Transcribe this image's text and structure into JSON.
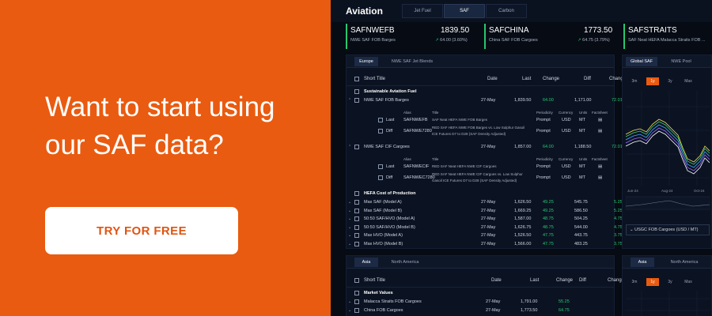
{
  "promo": {
    "headline": "Want to start using our SAF data?",
    "cta_label": "TRY FOR FREE"
  },
  "app": {
    "title": "Aviation",
    "top_tabs": [
      {
        "label": "Jet Fuel",
        "active": false
      },
      {
        "label": "SAF",
        "active": true
      },
      {
        "label": "Carbon",
        "active": false
      }
    ],
    "tickers": [
      {
        "name": "SAFNWEFB",
        "price": "1839.50",
        "desc": "NWE SAF FOB Barges",
        "change": "64.00 (3.60%)"
      },
      {
        "name": "SAFCHINA",
        "price": "1773.50",
        "desc": "China SAF FOB Cargoes",
        "change": "64.75 (3.79%)"
      },
      {
        "name": "SAFSTRAITS",
        "price": "",
        "desc": "SAF Neat HEFA Malacca Straits FOB ...",
        "change": ""
      }
    ],
    "europe_panel": {
      "tabs": [
        {
          "label": "Europe",
          "active": true
        },
        {
          "label": "NWE SAF Jet Blends",
          "active": false
        }
      ],
      "columns": [
        "Short Title",
        "Date",
        "Last",
        "Change",
        "Diff",
        "Change"
      ],
      "sections": [
        {
          "title": "Sustainable Aviation Fuel"
        },
        {
          "title": "HEFA Cost of Production"
        }
      ],
      "group_rows": [
        {
          "name": "NWE SAF FOB Barges",
          "date": "27-May",
          "last": "1,839.50",
          "change": "64.00",
          "diff": "1,171.00",
          "change2": "72.01"
        },
        {
          "name": "NWE SAF CIF Cargoes",
          "date": "27-May",
          "last": "1,857.00",
          "change": "64.00",
          "diff": "1,188.50",
          "change2": "72.01"
        }
      ],
      "detail_headers": [
        "Alias",
        "Title",
        "Periodicity",
        "Currency",
        "Units",
        "Factsheet"
      ],
      "detail_rows": [
        {
          "type": "Last",
          "alias": "SAFNWEFB",
          "title": "SAF Neat HEFA NWE FOB Barges",
          "period": "Prompt",
          "cur": "USD",
          "unit": "MT"
        },
        {
          "type": "Diff",
          "alias": "SAFNWE7280",
          "title": "RED SAF HEFA NWE FOB Barges vs. Low Sulphur Gasoil",
          "title2": "ICE Futures D7 to D28 (SAF Density Adjusted)",
          "period": "Prompt",
          "cur": "USD",
          "unit": "MT"
        },
        {
          "type": "Last",
          "alias": "SAFNWECIF",
          "title": "RED SAF Neat HEFA NWE CIF Cargoes",
          "period": "Prompt",
          "cur": "USD",
          "unit": "MT"
        },
        {
          "type": "Diff",
          "alias": "SAFNWEC7280",
          "title": "RED SAF Neat HEFA NWE CIF Cargoes vs. Low Sulphur",
          "title2": "Gasoil ICE Futures D7 to D28 (SAF Density Adjusted)",
          "period": "Prompt",
          "cur": "USD",
          "unit": "MT"
        }
      ],
      "hefa_rows": [
        {
          "name": "Max SAF (Model A)",
          "date": "27-May",
          "last": "1,626.50",
          "change": "49.25",
          "diff": "545.75",
          "change2": "5.25"
        },
        {
          "name": "Max SAF (Model B)",
          "date": "27-May",
          "last": "1,669.25",
          "change": "49.25",
          "diff": "586.50",
          "change2": "5.25"
        },
        {
          "name": "50:50 SAF/HVO (Model A)",
          "date": "27-May",
          "last": "1,587.00",
          "change": "48.75",
          "diff": "504.25",
          "change2": "4.75"
        },
        {
          "name": "50:50 SAF/HVO (Model B)",
          "date": "27-May",
          "last": "1,626.75",
          "change": "48.75",
          "diff": "544.00",
          "change2": "4.75"
        },
        {
          "name": "Max HVO (Model A)",
          "date": "27-May",
          "last": "1,526.50",
          "change": "47.75",
          "diff": "443.75",
          "change2": "3.75"
        },
        {
          "name": "Max HVO (Model B)",
          "date": "27-May",
          "last": "1,566.00",
          "change": "47.75",
          "diff": "483.25",
          "change2": "3.75"
        }
      ]
    },
    "chart_panel": {
      "tabs": [
        {
          "label": "Global SAF",
          "active": true
        },
        {
          "label": "NWE Pool",
          "active": false
        }
      ],
      "ranges": [
        {
          "label": "3m",
          "active": false
        },
        {
          "label": "1y",
          "active": true
        },
        {
          "label": "3y",
          "active": false
        },
        {
          "label": "Max",
          "active": false
        }
      ],
      "x_labels": [
        "Jun-24",
        "Aug-24",
        "Oct-24"
      ],
      "series_select": "USGC FOB Cargoes (USD / MT)"
    },
    "asia_panel": {
      "tabs": [
        {
          "label": "Asia",
          "active": true
        },
        {
          "label": "North America",
          "active": false
        }
      ],
      "columns": [
        "Short Title",
        "Date",
        "Last",
        "Change",
        "Diff",
        "Change"
      ],
      "section": "Market Values",
      "rows": [
        {
          "name": "Malacca Straits FOB Cargoes",
          "date": "27-May",
          "last": "1,791.00",
          "change": "55.25"
        },
        {
          "name": "China FOB Cargoes",
          "date": "27-May",
          "last": "1,773.50",
          "change": "64.75"
        }
      ]
    },
    "asia_chart_panel": {
      "tabs": [
        {
          "label": "Asia",
          "active": true
        },
        {
          "label": "North America",
          "active": false
        }
      ],
      "ranges": [
        {
          "label": "3m",
          "active": false
        },
        {
          "label": "1y",
          "active": true
        },
        {
          "label": "3y",
          "active": false
        },
        {
          "label": "Max",
          "active": false
        }
      ]
    },
    "colors": {
      "accent": "#e95b10",
      "positive": "#28c76f",
      "background": "#060b14"
    }
  }
}
